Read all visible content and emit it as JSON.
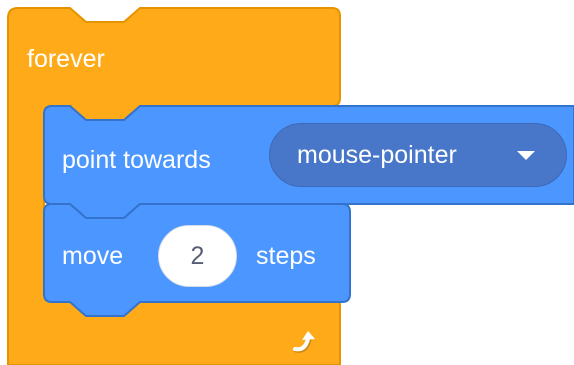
{
  "forever_block": {
    "label": "forever",
    "color": "#ffab19",
    "outline": "#e59400"
  },
  "point_towards_block": {
    "label": "point towards",
    "color": "#4c97ff",
    "outline": "#3373cc",
    "target_value": "mouse-pointer",
    "dropdown_icon": "caret-down-icon"
  },
  "move_block": {
    "label_before": "move",
    "steps_value": "2",
    "label_after": "steps",
    "color": "#4c97ff",
    "outline": "#3373cc"
  },
  "loop_icon": "loop-arrow-icon"
}
